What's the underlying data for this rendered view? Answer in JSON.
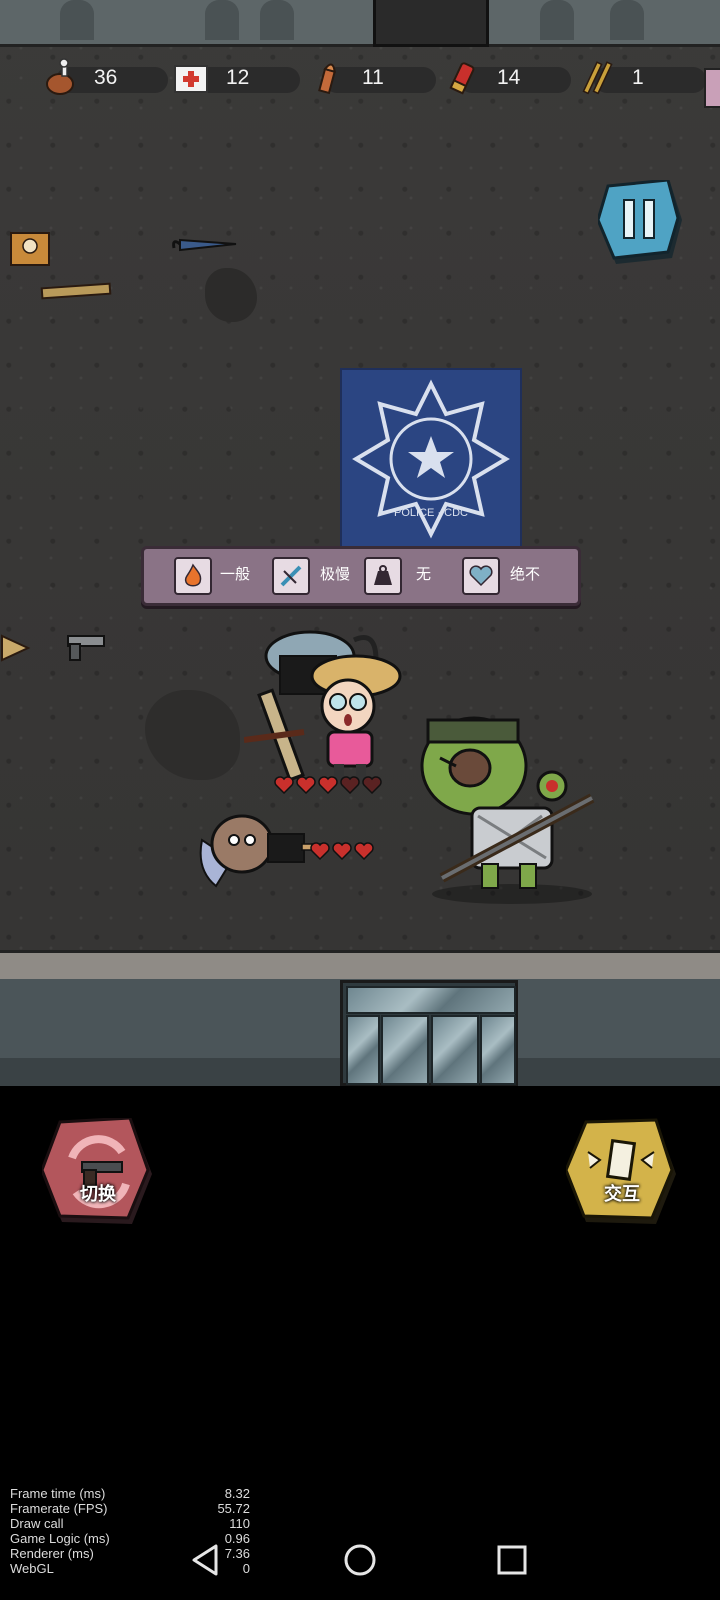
{
  "resources": [
    {
      "name": "meat",
      "icon": "drumstick-icon",
      "value": "36"
    },
    {
      "name": "medkit",
      "icon": "medkit-icon",
      "value": "12"
    },
    {
      "name": "pistol-ammo",
      "icon": "bullet-icon",
      "value": "11"
    },
    {
      "name": "shotgun-shells",
      "icon": "shotgun-shell-icon",
      "value": "14"
    },
    {
      "name": "rifle-ammo",
      "icon": "rifle-bullets-icon",
      "value": "1"
    }
  ],
  "weapon_stats": [
    {
      "icon": "fire-damage-icon",
      "label": "一般"
    },
    {
      "icon": "attack-speed-icon",
      "label": "极慢"
    },
    {
      "icon": "weight-icon",
      "label": "无"
    },
    {
      "icon": "durability-heart-icon",
      "label": "绝不"
    }
  ],
  "badge_text": "POLICE · CDC",
  "buttons": {
    "switch_label": "切换",
    "interact_label": "交互"
  },
  "player_hearts": {
    "filled": 3,
    "total": 5
  },
  "companion_hearts": {
    "filled": 3,
    "total": 3
  },
  "debug": [
    {
      "key": "Frame time (ms)",
      "value": "8.32"
    },
    {
      "key": "Framerate (FPS)",
      "value": "55.72"
    },
    {
      "key": "Draw call",
      "value": "110"
    },
    {
      "key": "Game Logic (ms)",
      "value": "0.96"
    },
    {
      "key": "Renderer (ms)",
      "value": "7.36"
    },
    {
      "key": "WebGL",
      "value": "0"
    }
  ],
  "colors": {
    "floor": "#3a3938",
    "stats_panel": "#8a7386",
    "pause_button": "#4fa3c4",
    "switch_button": "#b3565c",
    "interact_button": "#d3b34a",
    "heart": "#c9302c"
  }
}
